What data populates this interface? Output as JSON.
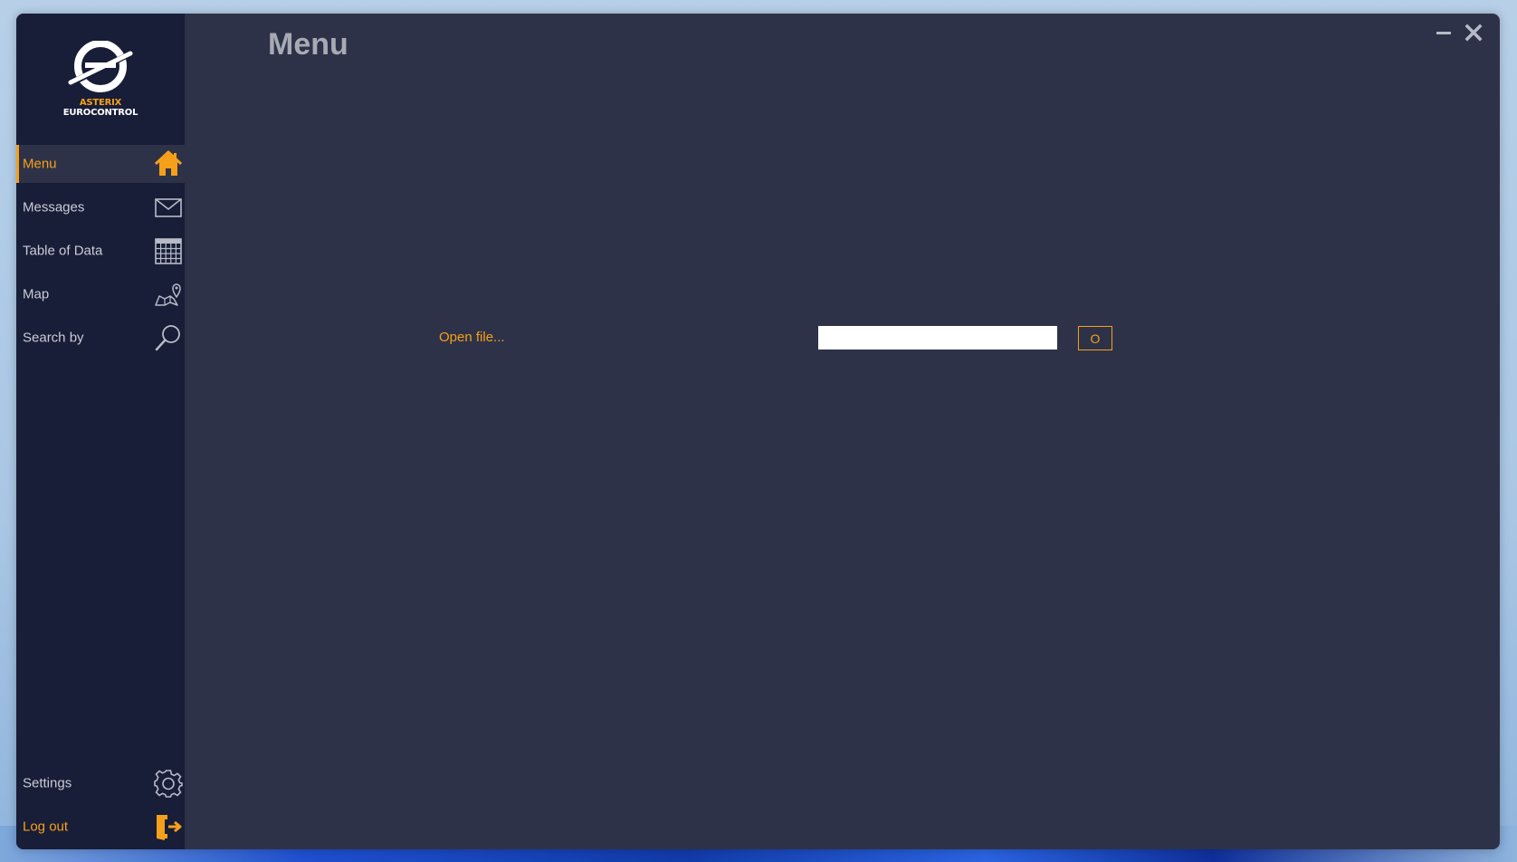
{
  "logo": {
    "line1": "ASTERIX",
    "line2": "EUROCONTROL"
  },
  "sidebar": {
    "items": [
      {
        "label": "Menu",
        "icon": "home-icon",
        "active": true
      },
      {
        "label": "Messages",
        "icon": "mail-icon"
      },
      {
        "label": "Table of Data",
        "icon": "grid-icon"
      },
      {
        "label": "Map",
        "icon": "map-pin-icon"
      },
      {
        "label": "Search by",
        "icon": "search-icon"
      }
    ],
    "bottom": [
      {
        "label": "Settings",
        "icon": "gear-icon"
      },
      {
        "label": "Log out",
        "icon": "logout-icon"
      }
    ]
  },
  "header": {
    "title": "Menu"
  },
  "main": {
    "open_file_label": "Open file...",
    "file_input_value": "",
    "open_button_label": "O"
  },
  "colors": {
    "accent": "#f5a01a",
    "sidebar_bg": "#181d38",
    "content_bg": "#2e3248",
    "title": "#a8aab4"
  }
}
